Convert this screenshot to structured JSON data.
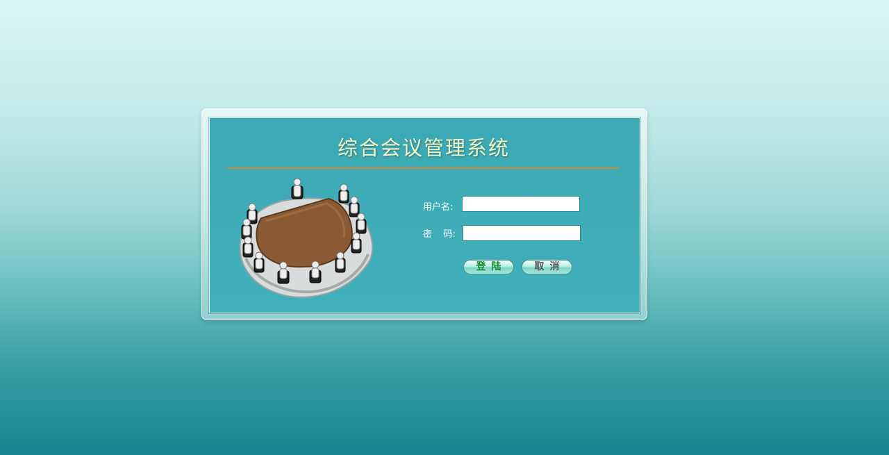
{
  "app": {
    "title": "综合会议管理系统"
  },
  "login_form": {
    "username_label": "用户名:",
    "username_value": "",
    "password_label": "密    码:",
    "password_value": "",
    "login_button_label": "登陆",
    "cancel_button_label": "取消"
  },
  "illustration": {
    "icon": "meeting-table-icon"
  },
  "colors": {
    "panel": "#3caab5",
    "title": "#f2f7c8",
    "divider": "#d08a2e",
    "login_text": "#138b2c",
    "cancel_text": "#555555"
  }
}
